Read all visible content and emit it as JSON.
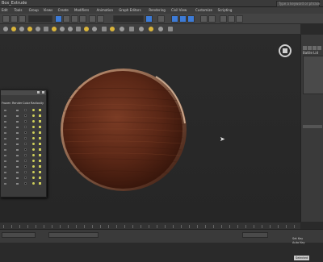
{
  "app": {
    "title": "Box_Extrude",
    "search_placeholder": "Type a keyword or phrase"
  },
  "menubar": {
    "items": [
      "Edit",
      "Tools",
      "Group",
      "Views",
      "Create",
      "Modifiers",
      "Animation",
      "Graph Editors",
      "Rendering",
      "Civil View",
      "Customize",
      "Scripting"
    ]
  },
  "toolbar": {
    "selection_filter": "All",
    "named_selection": "Create Selection Set"
  },
  "command_panel": {
    "object_name": "Battle Lid"
  },
  "viewport": {
    "object": {
      "type": "cylinder-cap",
      "material": "wood",
      "colors": {
        "dark": "#3d1a0e",
        "mid": "#6e3421",
        "light": "#8a4a2e",
        "rim": "#c08a6a"
      }
    }
  },
  "scene_explorer": {
    "columns": [
      "Frozen",
      "Render",
      "Color",
      "Radiosity"
    ],
    "row_count": 14
  },
  "status": {
    "auto_key": "Auto Key",
    "selected": "Selected",
    "set_key": "Set Key"
  },
  "colors": {
    "accent": "#3d7bd6",
    "ui_bg": "#3a3a3a",
    "viewport_bg": "#2a2a2a",
    "highlight": "#cfcf5a"
  }
}
